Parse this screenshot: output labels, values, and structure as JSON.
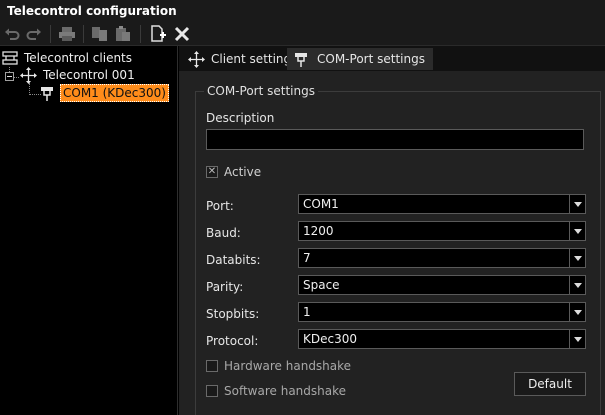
{
  "window": {
    "title": "Telecontrol configuration"
  },
  "toolbar": {
    "buttons": [
      {
        "name": "undo-icon",
        "glyph": "↶"
      },
      {
        "name": "redo-icon",
        "glyph": "↷"
      },
      {
        "name": "print-icon",
        "glyph": "🖶"
      },
      {
        "name": "copy-icon",
        "glyph": "⧉"
      },
      {
        "name": "paste-icon",
        "glyph": "📋"
      },
      {
        "name": "add-item-icon",
        "glyph": "+"
      },
      {
        "name": "delete-icon",
        "glyph": "✕"
      }
    ]
  },
  "tree": {
    "root": "Telecontrol clients",
    "client": "Telecontrol 001",
    "port": "COM1 (KDec300)"
  },
  "tabs": {
    "client_settings": "Client settings",
    "com_port_settings": "COM-Port settings"
  },
  "form": {
    "group_title": "COM-Port settings",
    "description_label": "Description",
    "description_value": "",
    "active_label": "Active",
    "active_checked": true,
    "port_label": "Port:",
    "port_value": "COM1",
    "baud_label": "Baud:",
    "baud_value": "1200",
    "databits_label": "Databits:",
    "databits_value": "7",
    "parity_label": "Parity:",
    "parity_value": "Space",
    "stopbits_label": "Stopbits:",
    "stopbits_value": "1",
    "protocol_label": "Protocol:",
    "protocol_value": "KDec300",
    "hardware_handshake_label": "Hardware handshake",
    "hardware_handshake_checked": false,
    "software_handshake_label": "Software handshake",
    "software_handshake_checked": false,
    "default_button": "Default",
    "check_glyph": "✕"
  },
  "colors": {
    "selection": "#ff8c1a",
    "background": "#000000",
    "panel": "#222222"
  }
}
